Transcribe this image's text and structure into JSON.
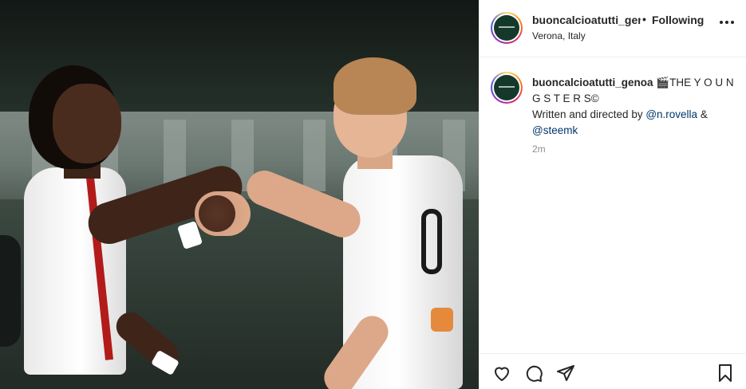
{
  "post": {
    "media": {
      "description_label": ""
    },
    "header": {
      "username": "buoncalcioatutti_genoa",
      "separator": "•",
      "follow_status": "Following",
      "location": "Verona, Italy"
    },
    "caption": {
      "username": "buoncalcioatutti_genoa",
      "text_before": " 🎬THE Y O U N G S T E R S©",
      "line2_prefix": "Written and directed by ",
      "mention1": "@n.rovella",
      "amp": " &",
      "mention2": "@steemk"
    },
    "time_ago": "2m"
  },
  "colors": {
    "text": "#262626",
    "mention": "#00376b",
    "muted": "#8e8e8e",
    "border": "#efefef"
  },
  "icons": {
    "like": "heart-icon",
    "comment": "comment-icon",
    "share": "paper-plane-icon",
    "save": "bookmark-icon",
    "more": "more-options-icon"
  }
}
